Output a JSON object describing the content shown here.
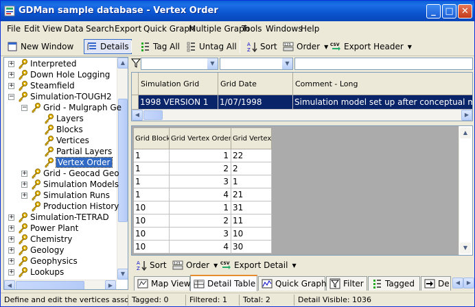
{
  "window": {
    "title": "GDMan sample database - Vertex Order"
  },
  "menu": [
    "File",
    "Edit",
    "View",
    "Data",
    "Search",
    "Export",
    "Quick Graph",
    "Multiple Graph",
    "Tools",
    "Windows",
    "Help"
  ],
  "toolbar": {
    "new_window": "New Window",
    "details": "Details",
    "tag_all": "Tag All",
    "untag_all": "Untag All",
    "sort": "Sort",
    "order": "Order",
    "export_header": "Export Header"
  },
  "tree": [
    {
      "label": "Interpreted",
      "expander": "+"
    },
    {
      "label": "Down Hole Logging",
      "expander": "+"
    },
    {
      "label": "Steamfield",
      "expander": "+"
    },
    {
      "label": "Simulation-TOUGH2",
      "expander": "−"
    },
    {
      "label": "Grid - Mulgraph Ge",
      "expander": "−"
    },
    {
      "label": "Layers",
      "expander": ""
    },
    {
      "label": "Blocks",
      "expander": ""
    },
    {
      "label": "Vertices",
      "expander": ""
    },
    {
      "label": "Partial Layers",
      "expander": ""
    },
    {
      "label": "Vertex Order",
      "expander": ""
    },
    {
      "label": "Grid - Geocad Geo",
      "expander": "+"
    },
    {
      "label": "Simulation Models",
      "expander": "+"
    },
    {
      "label": "Simulation Runs",
      "expander": "+"
    },
    {
      "label": "Production History",
      "expander": ""
    },
    {
      "label": "Simulation-TETRAD",
      "expander": "+"
    },
    {
      "label": "Power Plant",
      "expander": "+"
    },
    {
      "label": "Chemistry",
      "expander": "+"
    },
    {
      "label": "Geology",
      "expander": "+"
    },
    {
      "label": "Geophysics",
      "expander": "+"
    },
    {
      "label": "Lookups",
      "expander": "+"
    }
  ],
  "header_grid": {
    "columns": [
      "Simulation Grid",
      "Grid Date",
      "Comment - Long"
    ],
    "rows": [
      [
        "1998 VERSION 1",
        "1/07/1998",
        "Simulation model set up after conceptual mode"
      ]
    ]
  },
  "detail_grid": {
    "columns": [
      "Grid Block",
      "Grid Vertex Order",
      "Grid Vertex"
    ],
    "rows": [
      [
        "1",
        "1",
        "22"
      ],
      [
        "1",
        "2",
        "2"
      ],
      [
        "1",
        "3",
        "1"
      ],
      [
        "1",
        "4",
        "21"
      ],
      [
        "10",
        "1",
        "31"
      ],
      [
        "10",
        "2",
        "11"
      ],
      [
        "10",
        "3",
        "10"
      ],
      [
        "10",
        "4",
        "30"
      ]
    ]
  },
  "detail_toolbar": {
    "sort": "Sort",
    "order": "Order",
    "export_detail": "Export Detail"
  },
  "tabs": [
    "Map View",
    "Detail Table",
    "Quick Graph",
    "Filter",
    "Tagged",
    "De"
  ],
  "status": {
    "hint": "Define and edit the vertices associated",
    "tagged": "Tagged: 0",
    "filtered": "Filtered: 1",
    "total": "Total: 2",
    "detail_visible": "Detail Visible: 1036"
  },
  "colors": {
    "selection": "#0a246a",
    "tree_selection": "#316ac5",
    "titlebar": "#0b55d0"
  }
}
